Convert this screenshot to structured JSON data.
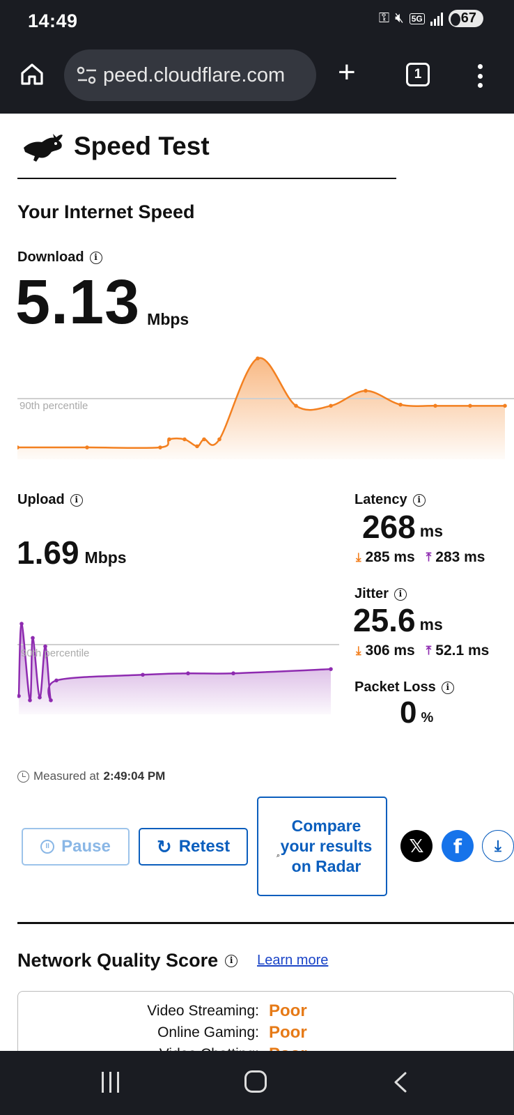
{
  "status_bar": {
    "time": "14:49",
    "network": "5G",
    "battery": "67"
  },
  "browser": {
    "url": "peed.cloudflare.com",
    "tab_count": "1"
  },
  "page": {
    "brand_title": "Speed Test",
    "section_title": "Your Internet Speed",
    "download": {
      "label": "Download",
      "value": "5.13",
      "unit": "Mbps",
      "percentile_label": "90th percentile"
    },
    "upload": {
      "label": "Upload",
      "value": "1.69",
      "unit": "Mbps",
      "percentile_label": "90th percentile"
    },
    "latency": {
      "label": "Latency",
      "value": "268",
      "unit": "ms",
      "down": "285 ms",
      "up": "283 ms"
    },
    "jitter": {
      "label": "Jitter",
      "value": "25.6",
      "unit": "ms",
      "down": "306 ms",
      "up": "52.1 ms"
    },
    "packet_loss": {
      "label": "Packet Loss",
      "value": "0",
      "unit": "%"
    },
    "measured": {
      "prefix": "Measured at",
      "time": "2:49:04 PM"
    },
    "buttons": {
      "pause": "Pause",
      "retest": "Retest",
      "compare": "Compare your results on Radar"
    },
    "network_quality": {
      "title": "Network Quality Score",
      "learn_more": "Learn more",
      "rows": [
        {
          "label": "Video Streaming:",
          "score": "Poor"
        },
        {
          "label": "Online Gaming:",
          "score": "Poor"
        },
        {
          "label": "Video Chatting:",
          "score": "Poor"
        }
      ]
    }
  },
  "colors": {
    "download": "#f38020",
    "upload": "#8e2bb0",
    "link": "#0b5ebd"
  },
  "chart_data": [
    {
      "type": "area",
      "series": [
        {
          "name": "Download",
          "values": [
            0.3,
            0.3,
            0.3,
            1.0,
            1.0,
            0.4,
            1.0,
            1.0,
            8.0,
            3.9,
            3.9,
            5.2,
            4.0,
            3.9,
            3.9,
            3.9
          ]
        }
      ],
      "annotation": "90th percentile"
    },
    {
      "type": "area",
      "series": [
        {
          "name": "Upload",
          "values": [
            0.35,
            2.9,
            0.2,
            2.4,
            0.3,
            2.1,
            0.2,
            0.9,
            1.1,
            1.15,
            1.15,
            1.3
          ]
        }
      ],
      "annotation": "90th percentile"
    }
  ]
}
